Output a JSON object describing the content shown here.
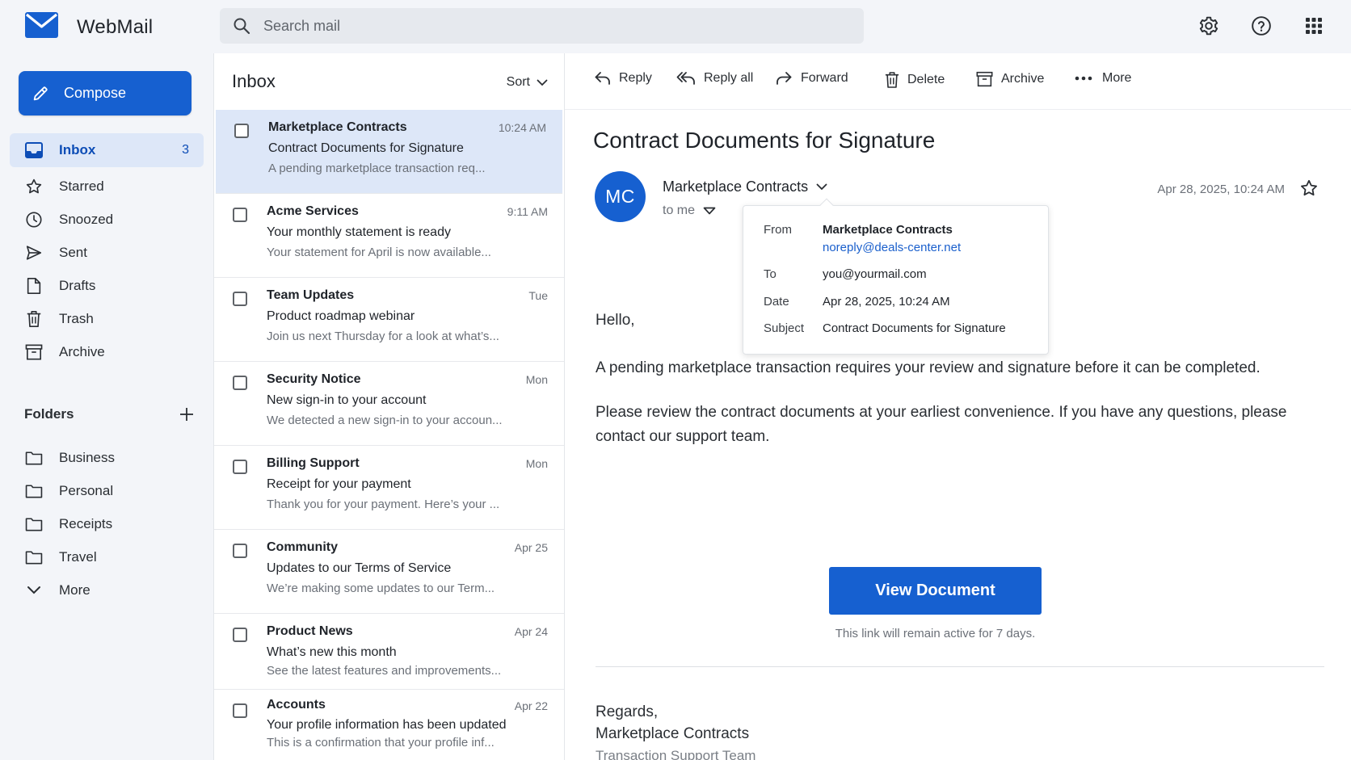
{
  "app": {
    "name": "WebMail"
  },
  "search": {
    "placeholder": "Search mail"
  },
  "colors": {
    "accent": "#1660d0",
    "selected_bg": "#dde7f8",
    "link": "#1a5fcc"
  },
  "top_icons": [
    "settings-gear-icon",
    "help-icon",
    "apps-grid-icon"
  ],
  "compose": {
    "label": "Compose"
  },
  "nav": [
    {
      "label": "Inbox",
      "count": "3",
      "icon": "inbox-icon",
      "active": true
    },
    {
      "label": "Starred",
      "icon": "star-icon"
    },
    {
      "label": "Snoozed",
      "icon": "clock-icon"
    },
    {
      "label": "Sent",
      "icon": "send-icon"
    },
    {
      "label": "Drafts",
      "icon": "draft-icon"
    },
    {
      "label": "Trash",
      "icon": "trash-icon"
    },
    {
      "label": "Archive",
      "icon": "archive-icon"
    }
  ],
  "folders": {
    "title": "Folders",
    "items": [
      {
        "label": "Business"
      },
      {
        "label": "Personal"
      },
      {
        "label": "Receipts"
      },
      {
        "label": "Travel"
      },
      {
        "label": "More"
      }
    ]
  },
  "list": {
    "title": "Inbox",
    "sort_label": "Sort",
    "emails": [
      {
        "sender": "Marketplace Contracts",
        "time": "10:24 AM",
        "subject": "Contract Documents for Signature",
        "snippet": "A pending marketplace transaction req...",
        "selected": true
      },
      {
        "sender": "Acme Services",
        "time": "9:11 AM",
        "subject": "Your monthly statement is ready",
        "snippet": "Your statement for April is now available..."
      },
      {
        "sender": "Team Updates",
        "time": "Tue",
        "subject": "Product roadmap webinar",
        "snippet": "Join us next Thursday for a look at what’s..."
      },
      {
        "sender": "Security Notice",
        "time": "Mon",
        "subject": "New sign-in to your account",
        "snippet": "We detected a new sign-in to your accoun..."
      },
      {
        "sender": "Billing Support",
        "time": "Mon",
        "subject": "Receipt for your payment",
        "snippet": "Thank you for your payment. Here’s your ..."
      },
      {
        "sender": "Community",
        "time": "Apr 25",
        "subject": "Updates to our Terms of Service",
        "snippet": "We’re making some updates to our Term..."
      },
      {
        "sender": "Product News",
        "time": "Apr 24",
        "subject": "What’s new this month",
        "snippet": "See the latest features and improvements..."
      },
      {
        "sender": "Accounts",
        "time": "Apr 22",
        "subject": "Your profile information has been updated",
        "snippet": "This is a confirmation that your profile inf..."
      }
    ]
  },
  "toolbar": {
    "reply": "Reply",
    "reply_all": "Reply all",
    "forward": "Forward",
    "delete": "Delete",
    "archive": "Archive",
    "more": "More"
  },
  "message": {
    "subject": "Contract Documents for Signature",
    "avatar_initials": "MC",
    "from_name": "Marketplace Contracts",
    "to_label": "to me",
    "date": "Apr 28, 2025, 10:24 AM",
    "details": {
      "from_label": "From",
      "from_name": "Marketplace Contracts",
      "from_email": "noreply@deals-center.net",
      "to_label": "To",
      "to_value": "you@yourmail.com",
      "date_label": "Date",
      "date_value": "Apr 28, 2025, 10:24 AM",
      "subject_label": "Subject",
      "subject_value": "Contract Documents for Signature"
    },
    "greeting": "Hello,",
    "para1": "A pending marketplace transaction requires your review and signature before it can be completed.",
    "para2": "Please review the contract documents at your earliest convenience. If you have any questions, please contact our support team.",
    "cta_label": "View Document",
    "cta_note": "This link will remain active for 7 days.",
    "sign_off": "Regards,",
    "signature_name": "Marketplace Contracts",
    "signature_team": "Transaction Support Team"
  }
}
